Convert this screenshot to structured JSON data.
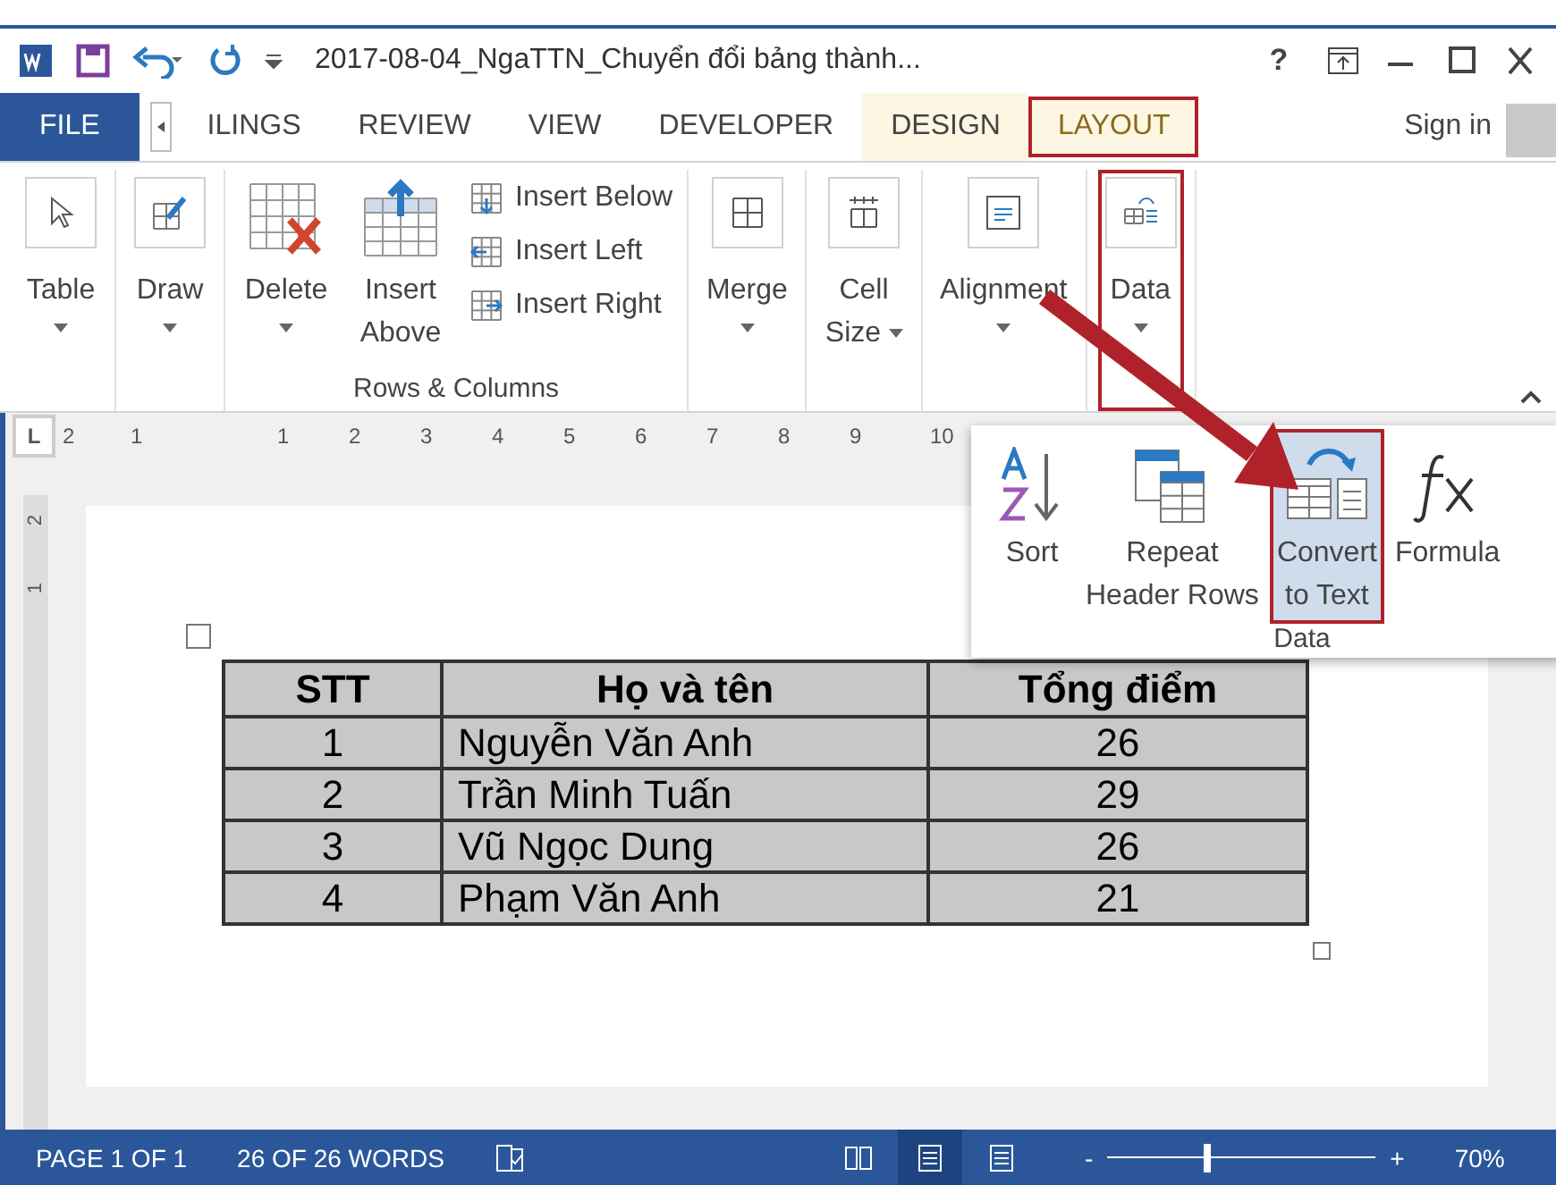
{
  "title_bar": {
    "title": "2017-08-04_NgaTTN_Chuyển đổi bảng thành...",
    "help": "?"
  },
  "tabs": [
    {
      "label": "FILE",
      "kind": "file",
      "selected": false,
      "highlighted": false
    },
    {
      "label": "ILINGS",
      "kind": "normal",
      "selected": false,
      "highlighted": false
    },
    {
      "label": "REVIEW",
      "kind": "normal",
      "selected": false,
      "highlighted": false
    },
    {
      "label": "VIEW",
      "kind": "normal",
      "selected": false,
      "highlighted": false
    },
    {
      "label": "DEVELOPER",
      "kind": "normal",
      "selected": false,
      "highlighted": false
    },
    {
      "label": "DESIGN",
      "kind": "context",
      "selected": false,
      "highlighted": false
    },
    {
      "label": "LAYOUT",
      "kind": "context",
      "selected": true,
      "highlighted": true
    }
  ],
  "sign_in": "Sign in",
  "ribbon": {
    "table": {
      "label": "Table"
    },
    "draw": {
      "label": "Draw"
    },
    "rows_columns": {
      "delete": "Delete",
      "insert_above": [
        "Insert",
        "Above"
      ],
      "small": [
        {
          "label": "Insert Below",
          "kind": "below"
        },
        {
          "label": "Insert Left",
          "kind": "left"
        },
        {
          "label": "Insert Right",
          "kind": "right"
        }
      ],
      "group_label": "Rows & Columns"
    },
    "merge": {
      "label": "Merge"
    },
    "cell_size": {
      "label": [
        "Cell",
        "Size"
      ]
    },
    "alignment": {
      "label": "Alignment"
    },
    "data": {
      "label": "Data",
      "highlighted": true
    }
  },
  "ruler": {
    "tab_stop": "L",
    "numbers": [
      "2",
      "1",
      "1",
      "2",
      "3",
      "4",
      "5",
      "6",
      "7",
      "8",
      "9",
      "10"
    ],
    "vertical_numbers": [
      "2",
      "1"
    ]
  },
  "data_panel": {
    "items": [
      {
        "kind": "sort",
        "label": [
          "Sort"
        ],
        "highlighted": false
      },
      {
        "kind": "repeat",
        "label": [
          "Repeat",
          "Header Rows"
        ],
        "highlighted": false
      },
      {
        "kind": "convert",
        "label": [
          "Convert",
          "to Text"
        ],
        "highlighted": true
      },
      {
        "kind": "formula",
        "label": [
          "Formula"
        ],
        "highlighted": false
      }
    ],
    "group_label": "Data"
  },
  "table": {
    "selected": true,
    "columns": [
      "STT",
      "Họ và tên",
      "Tổng điểm"
    ],
    "rows": [
      [
        "1",
        "Nguyễn Văn Anh",
        "26"
      ],
      [
        "2",
        "Trần Minh Tuấn",
        "29"
      ],
      [
        "3",
        "Vũ Ngọc Dung",
        "26"
      ],
      [
        "4",
        "Phạm Văn Anh",
        "21"
      ]
    ]
  },
  "status_bar": {
    "page": "PAGE 1 OF 1",
    "words": "26 OF 26 WORDS",
    "views": [
      {
        "kind": "read",
        "selected": false
      },
      {
        "kind": "print",
        "selected": true
      },
      {
        "kind": "web",
        "selected": false
      }
    ],
    "zoom": {
      "minus": "-",
      "plus": "+",
      "level": 0.37,
      "reading": "70%"
    }
  }
}
